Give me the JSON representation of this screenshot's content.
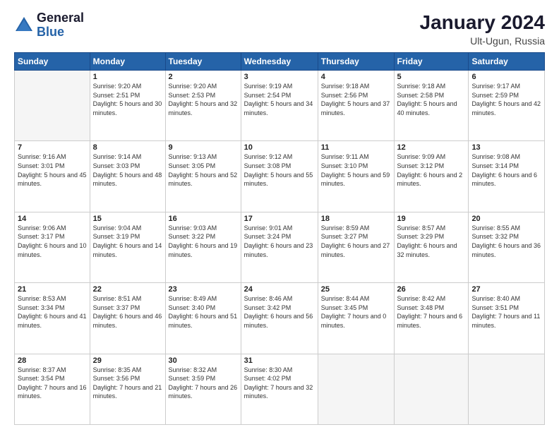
{
  "header": {
    "logo_general": "General",
    "logo_blue": "Blue",
    "month_year": "January 2024",
    "location": "Ult-Ugun, Russia"
  },
  "days_of_week": [
    "Sunday",
    "Monday",
    "Tuesday",
    "Wednesday",
    "Thursday",
    "Friday",
    "Saturday"
  ],
  "weeks": [
    [
      {
        "day": "",
        "sunrise": "",
        "sunset": "",
        "daylight": ""
      },
      {
        "day": "1",
        "sunrise": "9:20 AM",
        "sunset": "2:51 PM",
        "daylight": "5 hours and 30 minutes."
      },
      {
        "day": "2",
        "sunrise": "9:20 AM",
        "sunset": "2:53 PM",
        "daylight": "5 hours and 32 minutes."
      },
      {
        "day": "3",
        "sunrise": "9:19 AM",
        "sunset": "2:54 PM",
        "daylight": "5 hours and 34 minutes."
      },
      {
        "day": "4",
        "sunrise": "9:18 AM",
        "sunset": "2:56 PM",
        "daylight": "5 hours and 37 minutes."
      },
      {
        "day": "5",
        "sunrise": "9:18 AM",
        "sunset": "2:58 PM",
        "daylight": "5 hours and 40 minutes."
      },
      {
        "day": "6",
        "sunrise": "9:17 AM",
        "sunset": "2:59 PM",
        "daylight": "5 hours and 42 minutes."
      }
    ],
    [
      {
        "day": "7",
        "sunrise": "9:16 AM",
        "sunset": "3:01 PM",
        "daylight": "5 hours and 45 minutes."
      },
      {
        "day": "8",
        "sunrise": "9:14 AM",
        "sunset": "3:03 PM",
        "daylight": "5 hours and 48 minutes."
      },
      {
        "day": "9",
        "sunrise": "9:13 AM",
        "sunset": "3:05 PM",
        "daylight": "5 hours and 52 minutes."
      },
      {
        "day": "10",
        "sunrise": "9:12 AM",
        "sunset": "3:08 PM",
        "daylight": "5 hours and 55 minutes."
      },
      {
        "day": "11",
        "sunrise": "9:11 AM",
        "sunset": "3:10 PM",
        "daylight": "5 hours and 59 minutes."
      },
      {
        "day": "12",
        "sunrise": "9:09 AM",
        "sunset": "3:12 PM",
        "daylight": "6 hours and 2 minutes."
      },
      {
        "day": "13",
        "sunrise": "9:08 AM",
        "sunset": "3:14 PM",
        "daylight": "6 hours and 6 minutes."
      }
    ],
    [
      {
        "day": "14",
        "sunrise": "9:06 AM",
        "sunset": "3:17 PM",
        "daylight": "6 hours and 10 minutes."
      },
      {
        "day": "15",
        "sunrise": "9:04 AM",
        "sunset": "3:19 PM",
        "daylight": "6 hours and 14 minutes."
      },
      {
        "day": "16",
        "sunrise": "9:03 AM",
        "sunset": "3:22 PM",
        "daylight": "6 hours and 19 minutes."
      },
      {
        "day": "17",
        "sunrise": "9:01 AM",
        "sunset": "3:24 PM",
        "daylight": "6 hours and 23 minutes."
      },
      {
        "day": "18",
        "sunrise": "8:59 AM",
        "sunset": "3:27 PM",
        "daylight": "6 hours and 27 minutes."
      },
      {
        "day": "19",
        "sunrise": "8:57 AM",
        "sunset": "3:29 PM",
        "daylight": "6 hours and 32 minutes."
      },
      {
        "day": "20",
        "sunrise": "8:55 AM",
        "sunset": "3:32 PM",
        "daylight": "6 hours and 36 minutes."
      }
    ],
    [
      {
        "day": "21",
        "sunrise": "8:53 AM",
        "sunset": "3:34 PM",
        "daylight": "6 hours and 41 minutes."
      },
      {
        "day": "22",
        "sunrise": "8:51 AM",
        "sunset": "3:37 PM",
        "daylight": "6 hours and 46 minutes."
      },
      {
        "day": "23",
        "sunrise": "8:49 AM",
        "sunset": "3:40 PM",
        "daylight": "6 hours and 51 minutes."
      },
      {
        "day": "24",
        "sunrise": "8:46 AM",
        "sunset": "3:42 PM",
        "daylight": "6 hours and 56 minutes."
      },
      {
        "day": "25",
        "sunrise": "8:44 AM",
        "sunset": "3:45 PM",
        "daylight": "7 hours and 0 minutes."
      },
      {
        "day": "26",
        "sunrise": "8:42 AM",
        "sunset": "3:48 PM",
        "daylight": "7 hours and 6 minutes."
      },
      {
        "day": "27",
        "sunrise": "8:40 AM",
        "sunset": "3:51 PM",
        "daylight": "7 hours and 11 minutes."
      }
    ],
    [
      {
        "day": "28",
        "sunrise": "8:37 AM",
        "sunset": "3:54 PM",
        "daylight": "7 hours and 16 minutes."
      },
      {
        "day": "29",
        "sunrise": "8:35 AM",
        "sunset": "3:56 PM",
        "daylight": "7 hours and 21 minutes."
      },
      {
        "day": "30",
        "sunrise": "8:32 AM",
        "sunset": "3:59 PM",
        "daylight": "7 hours and 26 minutes."
      },
      {
        "day": "31",
        "sunrise": "8:30 AM",
        "sunset": "4:02 PM",
        "daylight": "7 hours and 32 minutes."
      },
      {
        "day": "",
        "sunrise": "",
        "sunset": "",
        "daylight": ""
      },
      {
        "day": "",
        "sunrise": "",
        "sunset": "",
        "daylight": ""
      },
      {
        "day": "",
        "sunrise": "",
        "sunset": "",
        "daylight": ""
      }
    ]
  ]
}
